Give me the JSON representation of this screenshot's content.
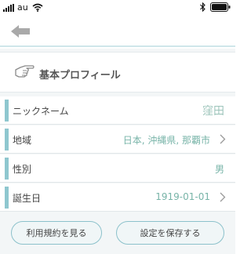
{
  "status_bar": {
    "carrier": "au",
    "icons": [
      "signal-icon",
      "wifi-icon",
      "bluetooth-icon",
      "battery-icon"
    ]
  },
  "header": {
    "back_icon": "back-arrow-icon"
  },
  "section": {
    "icon": "pointing-hand-icon",
    "title": "基本プロフィール"
  },
  "rows": [
    {
      "label": "ニックネーム",
      "value": "窪田"
    },
    {
      "label": "地域",
      "value": "日本, 沖縄県, 那覇市"
    },
    {
      "label": "性別",
      "value": "男"
    },
    {
      "label": "誕生日",
      "value": "1919-01-01"
    }
  ],
  "buttons": {
    "terms_label": "利用規約を見る",
    "save_label": "設定を保存する"
  },
  "colors": {
    "accent": "#8fc7cf",
    "value_text": "#78b4a8",
    "background": "#f3f6f7"
  }
}
